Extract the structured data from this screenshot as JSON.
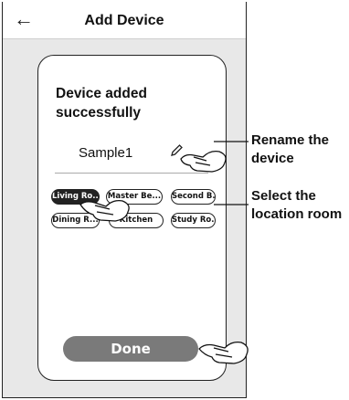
{
  "header": {
    "title": "Add Device",
    "back_icon": "arrow-left-icon"
  },
  "card": {
    "message": "Device added successfully",
    "device_name": "Sample1",
    "edit_icon": "pencil-icon",
    "rooms": [
      {
        "label": "Living Ro...",
        "selected": true
      },
      {
        "label": "Master Be...",
        "selected": false
      },
      {
        "label": "Second B...",
        "selected": false
      },
      {
        "label": "Dining R...",
        "selected": false
      },
      {
        "label": "Kitchen",
        "selected": false
      },
      {
        "label": "Study Ro...",
        "selected": false
      }
    ],
    "done_label": "Done"
  },
  "annotations": {
    "rename": "Rename the device",
    "location": "Select the location room"
  },
  "colors": {
    "done_button": "#7a7a7a",
    "selected_room": "#222222",
    "background": "#e8e8e8"
  }
}
